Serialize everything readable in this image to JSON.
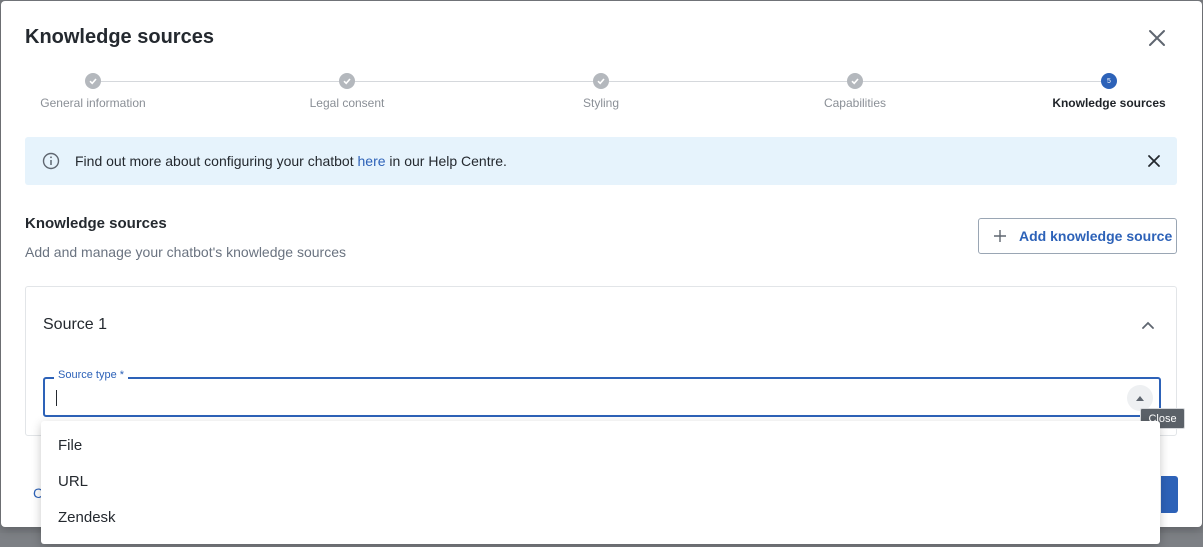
{
  "dialog": {
    "title": "Knowledge sources"
  },
  "stepper": {
    "steps": [
      {
        "label": "General information",
        "state": "done"
      },
      {
        "label": "Legal consent",
        "state": "done"
      },
      {
        "label": "Styling",
        "state": "done"
      },
      {
        "label": "Capabilities",
        "state": "done"
      },
      {
        "label": "Knowledge sources",
        "state": "active",
        "number": "5"
      }
    ]
  },
  "banner": {
    "text_before": "Find out more about configuring your chatbot ",
    "link": "here",
    "text_after": " in our Help Centre."
  },
  "section": {
    "title": "Knowledge sources",
    "subtitle": "Add and manage your chatbot's knowledge sources",
    "add_button": "Add knowledge source"
  },
  "source": {
    "title": "Source 1",
    "field_label": "Source type *",
    "value": "",
    "options": [
      "File",
      "URL",
      "Zendesk"
    ]
  },
  "tooltip": "Close",
  "footer": {
    "cancel_partial": "C"
  },
  "colors": {
    "accent": "#2d62b8",
    "banner_bg": "#e6f3fc",
    "done_step": "#b4b8bd"
  },
  "icons": {
    "close": "close-icon",
    "info": "info-icon",
    "check": "check-icon",
    "plus": "plus-icon",
    "chevron": "chevron-up-icon",
    "triangle": "triangle-up-icon"
  }
}
